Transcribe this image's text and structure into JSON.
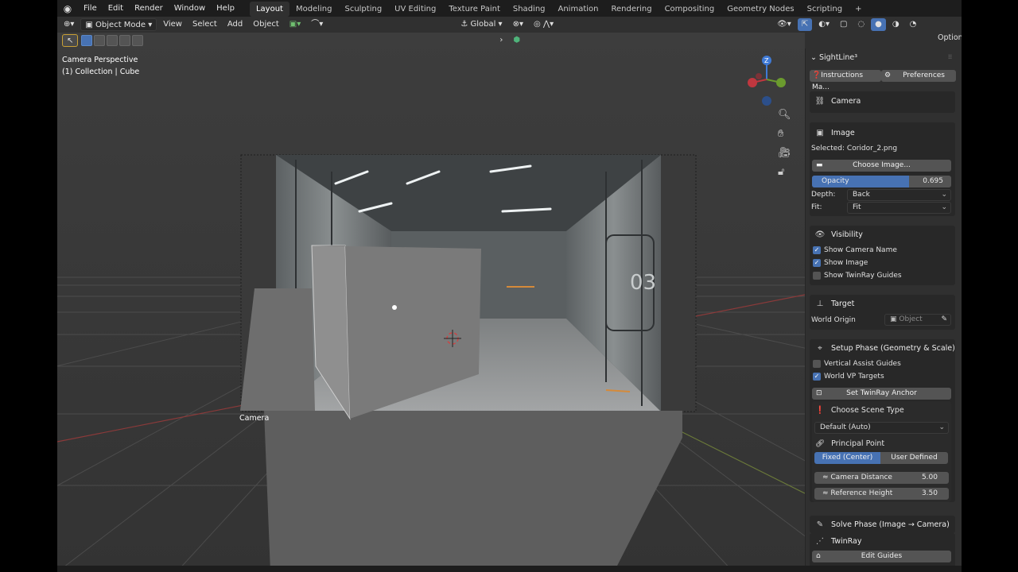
{
  "menu": {
    "items": [
      "File",
      "Edit",
      "Render",
      "Window",
      "Help"
    ],
    "workspaces": [
      "Layout",
      "Modeling",
      "Sculpting",
      "UV Editing",
      "Texture Paint",
      "Shading",
      "Animation",
      "Rendering",
      "Compositing",
      "Geometry Nodes",
      "Scripting"
    ],
    "active_workspace": "Layout",
    "add_workspace": "+"
  },
  "header": {
    "mode": "Object Mode",
    "view": "View",
    "select": "Select",
    "add": "Add",
    "object": "Object",
    "orientation": "Global",
    "options": "Options"
  },
  "viewport": {
    "view_name": "Camera Perspective",
    "collection": "(1) Collection | Cube",
    "camera_label": "Camera",
    "image_number": "03",
    "gizmo_axis": "Z",
    "accent_color": "#4772b3"
  },
  "sidebar": {
    "addon_title": "SightLine³",
    "instructions_button": "Instructions Ma...",
    "preferences_button": "Preferences",
    "camera_panel": "Camera",
    "image_panel": {
      "title": "Image",
      "selected": "Selected: Coridor_2.png",
      "choose_button": "Choose Image...",
      "opacity_label": "Opacity",
      "opacity_value": "0.695",
      "opacity_fraction": 0.695,
      "depth_label": "Depth:",
      "depth_value": "Back",
      "fit_label": "Fit:",
      "fit_value": "Fit"
    },
    "visibility_panel": {
      "title": "Visibility",
      "show_camera_name": "Show Camera Name",
      "show_image": "Show Image",
      "show_twinray_guides": "Show TwinRay Guides"
    },
    "target_panel": {
      "title": "Target",
      "world_origin": "World Origin",
      "object_placeholder": "Object"
    },
    "setup_panel": {
      "title": "Setup Phase (Geometry & Scale)",
      "vertical_assist": "Vertical Assist Guides",
      "world_vp_targets": "World VP Targets",
      "set_anchor_button": "Set TwinRay Anchor",
      "scene_type_title": "Choose Scene Type",
      "scene_type_value": "Default (Auto)",
      "principal_point_title": "Principal Point",
      "pp_fixed": "Fixed (Center)",
      "pp_user": "User Defined",
      "camera_distance_label": "≈ Camera Distance",
      "camera_distance_value": "5.00",
      "reference_height_label": "≈ Reference Height",
      "reference_height_value": "3.50"
    },
    "solve_panel": {
      "title": "Solve Phase (Image → Camera)"
    },
    "twinray_panel": {
      "title": "TwinRay",
      "edit_guides_button": "Edit Guides"
    }
  }
}
